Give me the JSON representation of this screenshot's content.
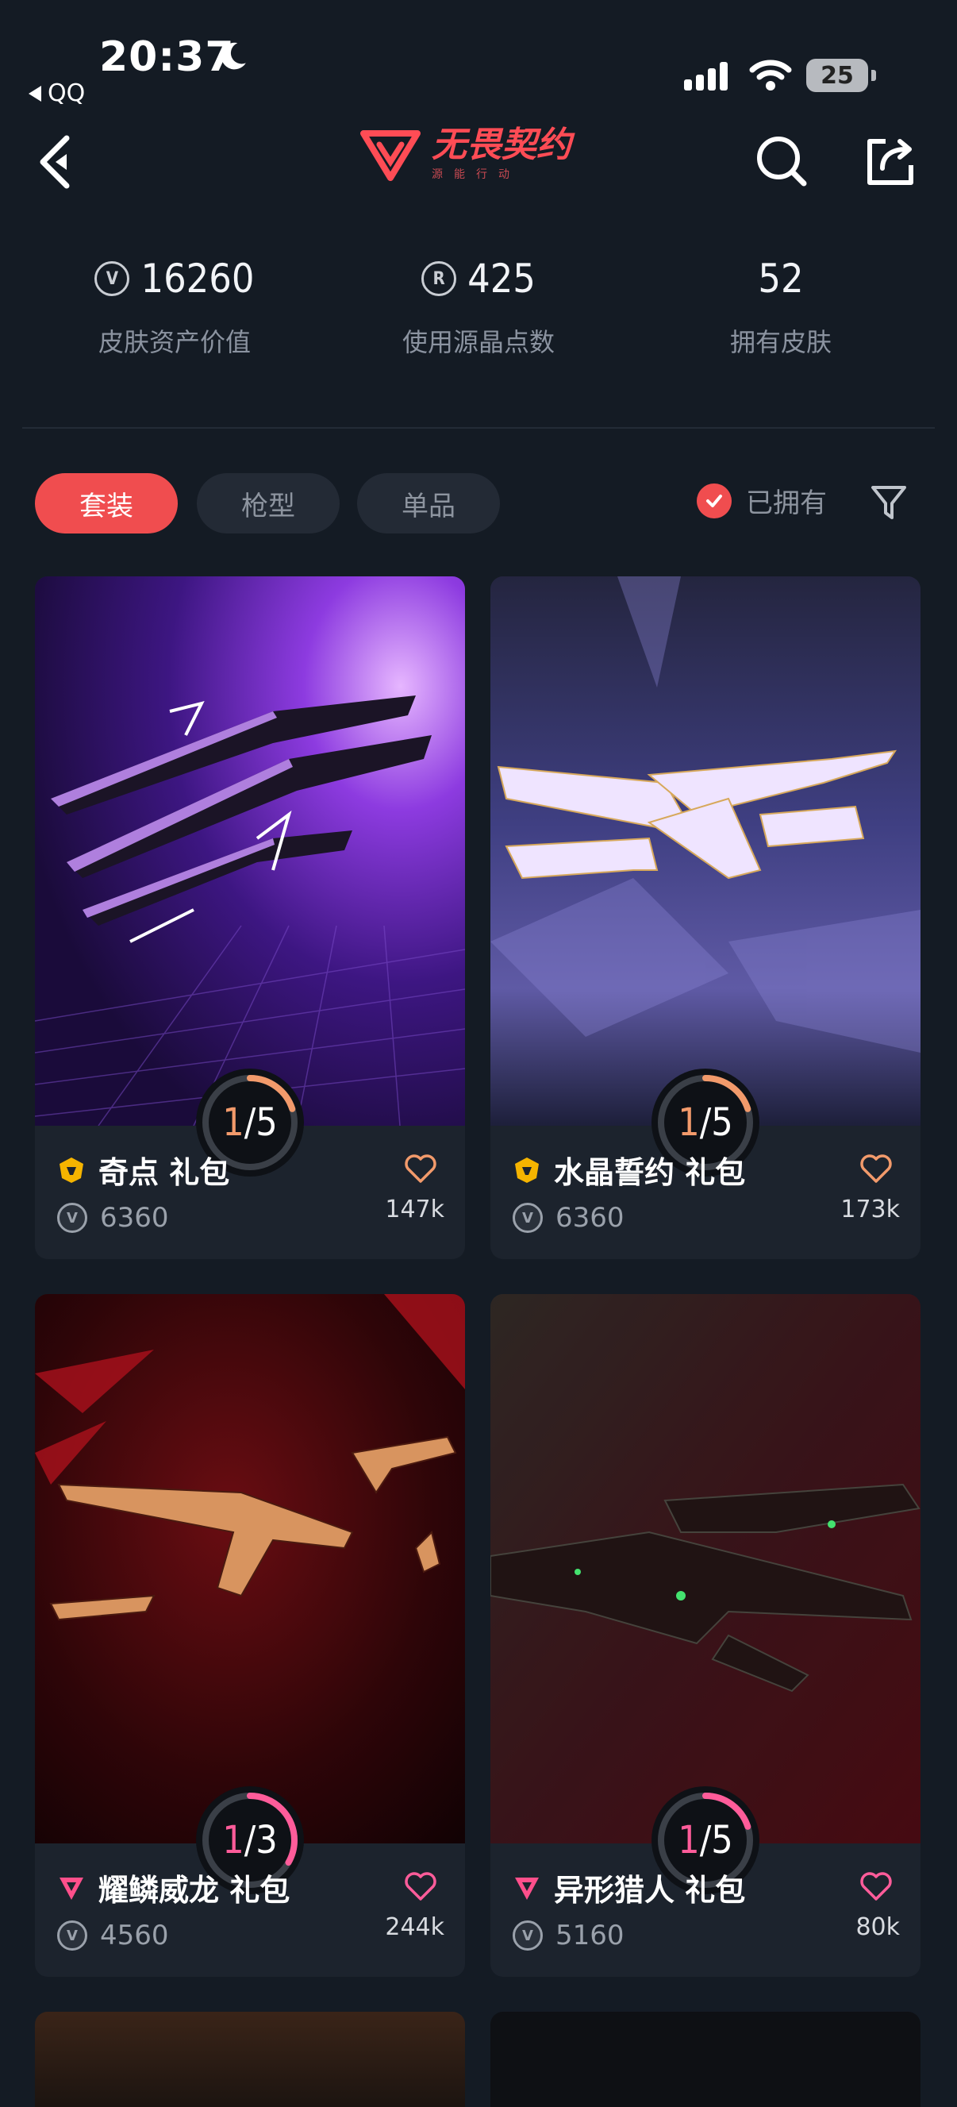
{
  "status": {
    "time": "20:37",
    "back_app": "QQ",
    "battery": "25"
  },
  "nav": {
    "logo_title": "无畏契约",
    "logo_sub": "源能行动"
  },
  "stats": [
    {
      "value": "16260",
      "label": "皮肤资产价值",
      "icon": "vp-icon"
    },
    {
      "value": "425",
      "label": "使用源晶点数",
      "icon": "radianite-icon"
    },
    {
      "value": "52",
      "label": "拥有皮肤",
      "icon": ""
    }
  ],
  "filters": {
    "tabs": [
      "套装",
      "枪型",
      "单品"
    ],
    "active": "套装",
    "owned_label": "已拥有",
    "owned_checked": true
  },
  "colors": {
    "accent": "#f04d4f",
    "bg": "#141b24",
    "card": "#1c232d",
    "premium_tier": "#f5b400",
    "exclusive_tier": "#ff4f8b"
  },
  "cards": [
    {
      "name": "奇点 礼包",
      "price": "6360",
      "likes": "147k",
      "owned": "1",
      "total": "5",
      "progress": 0.2,
      "tier": "premium",
      "ring_color": "#f29a6b"
    },
    {
      "name": "水晶誓约 礼包",
      "price": "6360",
      "likes": "173k",
      "owned": "1",
      "total": "5",
      "progress": 0.2,
      "tier": "premium",
      "ring_color": "#f29a6b"
    },
    {
      "name": "耀鳞威龙 礼包",
      "price": "4560",
      "likes": "244k",
      "owned": "1",
      "total": "3",
      "progress": 0.333,
      "tier": "exclusive",
      "ring_color": "#ff5c9a"
    },
    {
      "name": "异形猎人 礼包",
      "price": "5160",
      "likes": "80k",
      "owned": "1",
      "total": "5",
      "progress": 0.2,
      "tier": "exclusive",
      "ring_color": "#ff5c9a"
    }
  ]
}
